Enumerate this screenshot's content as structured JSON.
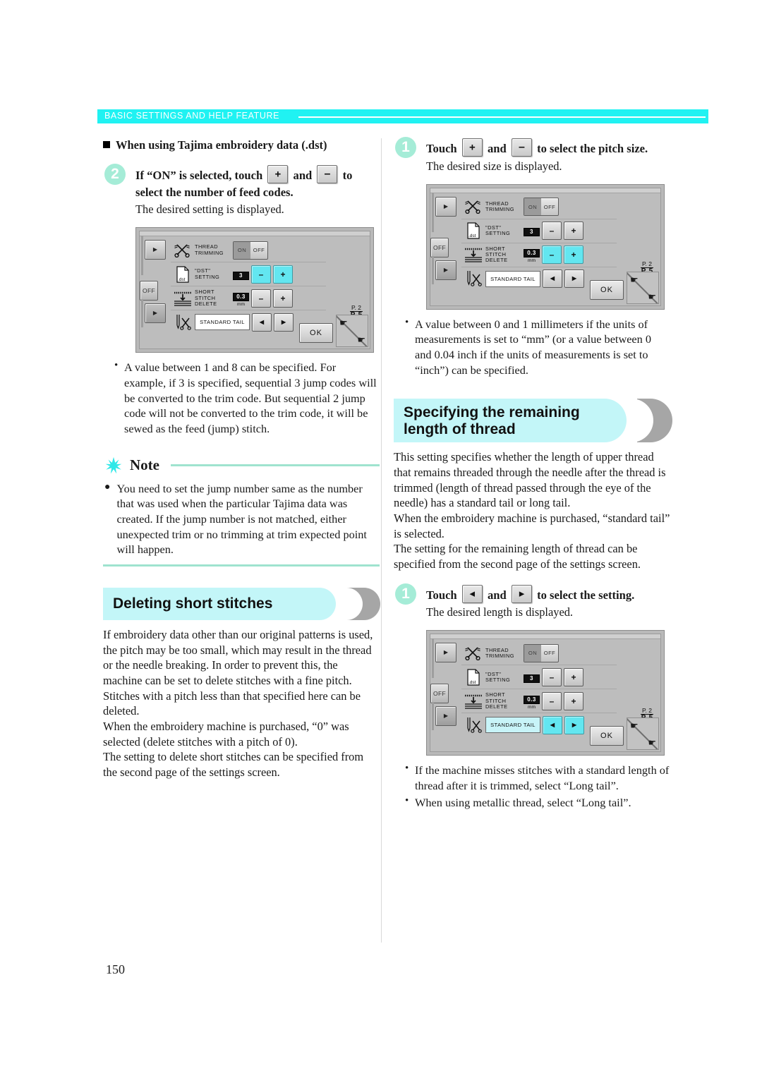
{
  "header": {
    "title": "BASIC SETTINGS AND HELP FEATURE"
  },
  "page_number": "150",
  "left_column": {
    "subsection_heading": "When using Tajima embroidery data (.dst)",
    "step2": {
      "number": "2",
      "title_part1": "If “ON” is selected, touch",
      "title_part2": "and",
      "title_part3": "to",
      "title_line2": "select the number of feed codes.",
      "subtitle": "The desired setting is displayed."
    },
    "bullets": [
      "A value between 1 and 8 can be specified. For example, if 3 is specified, sequential 3 jump codes will be converted to the trim code. But sequential 2 jump code will not be converted to the trim code, it will be sewed as the feed (jump) stitch."
    ],
    "note": {
      "label": "Note",
      "text": "You need to set the jump number same as the number that was used when the particular Tajima data was created. If the jump number is not matched, either unexpected trim or no trimming at trim expected point will happen."
    },
    "section_heading": "Deleting short stitches",
    "section_body": [
      "If embroidery data other than our original patterns is used, the pitch may be too small, which may result in the thread or the needle breaking. In order to prevent this, the machine can be set to delete stitches with a fine pitch. Stitches with a pitch less than that specified here can be deleted.",
      "When the embroidery machine is purchased, “0” was selected (delete stitches with a pitch of 0).",
      "The setting to delete short stitches can be specified from the second page of the settings screen."
    ]
  },
  "right_column": {
    "step1_pitch": {
      "number": "1",
      "title_part1": "Touch",
      "title_part2": "and",
      "title_part3": "to select the pitch size.",
      "subtitle": "The desired size is displayed."
    },
    "bullets_pitch": [
      "A value between 0 and 1 millimeters if the units of measurements is set to “mm” (or a value between 0 and 0.04 inch if the units of measurements is set to “inch”) can be specified."
    ],
    "section_heading_line1": "Specifying the remaining",
    "section_heading_line2": "length of thread",
    "section_body": [
      "This setting specifies whether the length of upper thread that remains threaded through the needle after the thread is trimmed (length of thread passed through the eye of the needle) has a standard tail or long tail.",
      "When the embroidery machine is purchased, “standard tail” is selected.",
      "The setting for the remaining length of thread can be specified from the second page of the settings screen."
    ],
    "step1_setting": {
      "number": "1",
      "title_part1": "Touch",
      "title_part2": "and",
      "title_part3": "to select the setting.",
      "subtitle": "The desired length is displayed."
    },
    "bullets_tail": [
      "If the machine misses stitches with a standard length of thread after it is trimmed, select “Long tail”.",
      "When using metallic thread, select “Long tail”."
    ]
  },
  "lcd_screens": {
    "screen_a": {
      "rows": {
        "thread_trimming": {
          "label": "THREAD\nTRIMMING",
          "on": "ON",
          "off": "OFF",
          "selected": "ON"
        },
        "dst_setting": {
          "label": "\"DST\"\nSETTING",
          "value": "3",
          "minus": "–",
          "plus": "+",
          "highlight": "dst"
        },
        "short_stitch_delete": {
          "label": "SHORT\nSTITCH\nDELETE",
          "value": "0.3",
          "unit": "mm",
          "minus": "–",
          "plus": "+"
        },
        "standard_tail": {
          "label": "",
          "field": "STANDARD TAIL",
          "left": "◀",
          "right": "▶"
        }
      },
      "page_top": "P. 2",
      "page_bottom": "P. 5",
      "ok": "OK"
    },
    "screen_b": {
      "rows": {
        "thread_trimming": {
          "label": "THREAD\nTRIMMING",
          "on": "ON",
          "off": "OFF",
          "selected": "ON"
        },
        "dst_setting": {
          "label": "\"DST\"\nSETTING",
          "value": "3",
          "minus": "–",
          "plus": "+"
        },
        "short_stitch_delete": {
          "label": "SHORT\nSTITCH\nDELETE",
          "value": "0.3",
          "unit": "mm",
          "minus": "–",
          "plus": "+",
          "highlight": "short"
        },
        "standard_tail": {
          "label": "",
          "field": "STANDARD TAIL",
          "left": "◀",
          "right": "▶"
        }
      },
      "page_top": "P. 2",
      "page_bottom": "P. 5",
      "ok": "OK"
    },
    "screen_c": {
      "rows": {
        "thread_trimming": {
          "label": "THREAD\nTRIMMING",
          "on": "ON",
          "off": "OFF",
          "selected": "ON"
        },
        "dst_setting": {
          "label": "\"DST\"\nSETTING",
          "value": "3",
          "minus": "–",
          "plus": "+"
        },
        "short_stitch_delete": {
          "label": "SHORT\nSTITCH\nDELETE",
          "value": "0.3",
          "unit": "mm",
          "minus": "–",
          "plus": "+"
        },
        "standard_tail": {
          "label": "",
          "field": "STANDARD TAIL",
          "left": "◀",
          "right": "▶",
          "highlight": "tail"
        }
      },
      "page_top": "P. 2",
      "page_bottom": "P. 5",
      "ok": "OK"
    },
    "rail": {
      "off_label": "OFF",
      "arrow": "▶"
    }
  },
  "colors": {
    "header_cyan": "#20f2f2",
    "pill_cyan": "#c3f6f8",
    "step_badge": "#a5ecd7",
    "note_rule": "#9fe3cf",
    "lcd_highlight": "#63e6f0"
  }
}
